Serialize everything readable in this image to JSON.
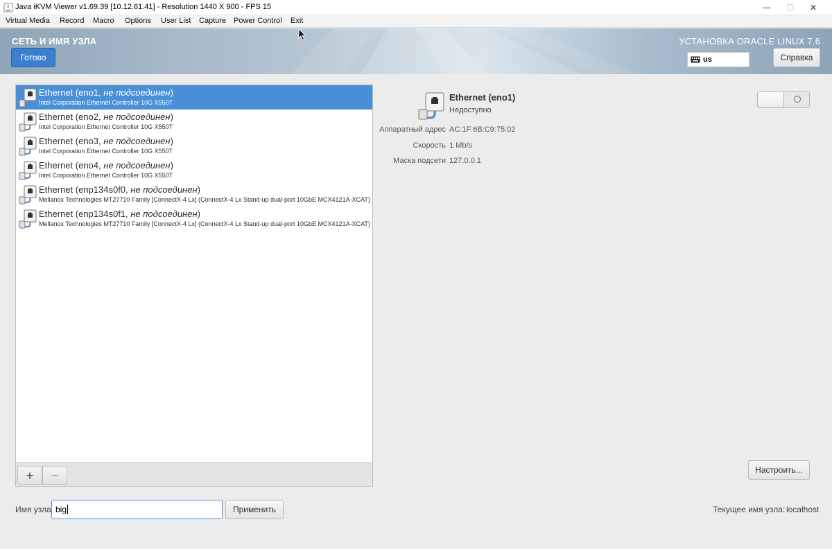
{
  "window": {
    "title": "Java iKVM Viewer v1.69.39 [10.12.61.41]  - Resolution 1440 X 900 - FPS 15",
    "controls": {
      "minimize": "—",
      "maximize": "☐",
      "close": "✕"
    }
  },
  "menubar": [
    "Virtual Media",
    "Record",
    "Macro",
    "Options",
    "User List",
    "Capture",
    "Power Control",
    "Exit"
  ],
  "header": {
    "title": "СЕТЬ И ИМЯ УЗЛА",
    "done_label": "Готово",
    "install_title": "УСТАНОВКА ORACLE LINUX 7.6",
    "keyboard_layout": "us",
    "help_label": "Справка"
  },
  "devices": [
    {
      "name": "Ethernet (eno1, ",
      "status": "не подсоединен",
      "close": ")",
      "description": "Intel Corporation Ethernet Controller 10G X550T",
      "selected": true
    },
    {
      "name": "Ethernet (eno2, ",
      "status": "не подсоединен",
      "close": ")",
      "description": "Intel Corporation Ethernet Controller 10G X550T",
      "selected": false
    },
    {
      "name": "Ethernet (eno3, ",
      "status": "не подсоединен",
      "close": ")",
      "description": "Intel Corporation Ethernet Controller 10G X550T",
      "selected": false
    },
    {
      "name": "Ethernet (eno4, ",
      "status": "не подсоединен",
      "close": ")",
      "description": "Intel Corporation Ethernet Controller 10G X550T",
      "selected": false
    },
    {
      "name": "Ethernet (enp134s0f0, ",
      "status": "не подсоединен",
      "close": ")",
      "description": "Mellanox Technologies MT27710 Family [ConnectX-4 Lx] (ConnectX-4 Lx Stand-up dual-port 10GbE MCX4121A-XCAT)",
      "selected": false
    },
    {
      "name": "Ethernet (enp134s0f1, ",
      "status": "не подсоединен",
      "close": ")",
      "description": "Mellanox Technologies MT27710 Family [ConnectX-4 Lx] (ConnectX-4 Lx Stand-up dual-port 10GbE MCX4121A-XCAT)",
      "selected": false
    }
  ],
  "list_toolbar": {
    "add": "+",
    "remove": "−"
  },
  "detail": {
    "name": "Ethernet (eno1)",
    "status": "Недоступно",
    "hw_label": "Аппаратный адрес",
    "hw_value": "AC:1F:6B:C9:75:02",
    "speed_label": "Скорость",
    "speed_value": "1 Mb/s",
    "mask_label": "Маска подсети",
    "mask_value": "127.0.0.1",
    "enabled": false,
    "configure_label": "Настроить..."
  },
  "hostname": {
    "label": "Имя узла:",
    "value": "big",
    "apply_label": "Применить",
    "current_label": "Текущее имя узла:",
    "current_value": "localhost"
  },
  "colors": {
    "selection": "#4a90d9",
    "done_button": "#3d7fcf",
    "background": "#ececec"
  }
}
